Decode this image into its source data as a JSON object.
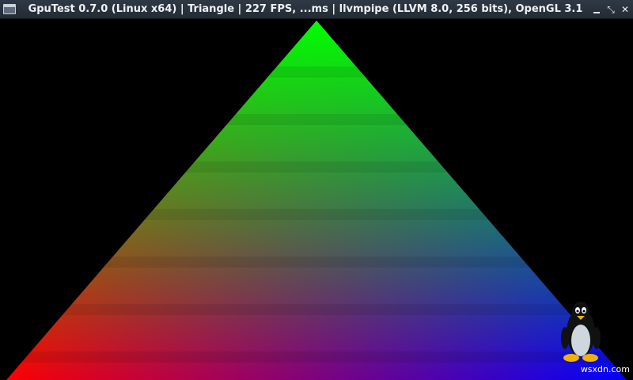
{
  "window": {
    "title": "GpuTest 0.7.0 (Linux x64) | Triangle | 227 FPS, ...ms | llvmpipe (LLVM 8.0, 256 bits), OpenGL 3.1",
    "buttons": {
      "minimize_icon": "minimize-icon",
      "maximize_glyph": "⤡",
      "close_glyph": "✕"
    }
  },
  "render": {
    "triangle_colors": {
      "top": "#00ff00",
      "bottom_left": "#ff0000",
      "bottom_right": "#0000ff"
    },
    "background": "#000000"
  },
  "watermark": {
    "text": "wsxdn.com",
    "icon": "tux-penguin-icon"
  }
}
